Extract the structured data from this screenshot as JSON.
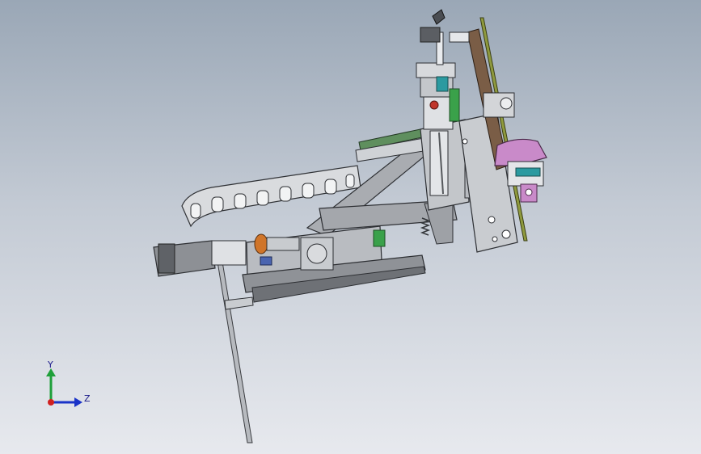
{
  "viewport": {
    "background_top": "#9aa7b6",
    "background_bottom": "#e7e9ee"
  },
  "model": {
    "steel_color": "#c8cbcf",
    "dark_steel_color": "#6e7176",
    "accent_orange": "#d0752a",
    "accent_green": "#3aa14a",
    "accent_teal": "#2b9aa0",
    "accent_pink": "#c98ac9",
    "accent_red": "#c0352a",
    "plate_brown": "#7a5d46"
  },
  "triad": {
    "y_label": "Y",
    "z_label": "Z",
    "y_color": "#1fa03a",
    "z_color": "#1a33c8",
    "origin_color": "#d02020"
  }
}
